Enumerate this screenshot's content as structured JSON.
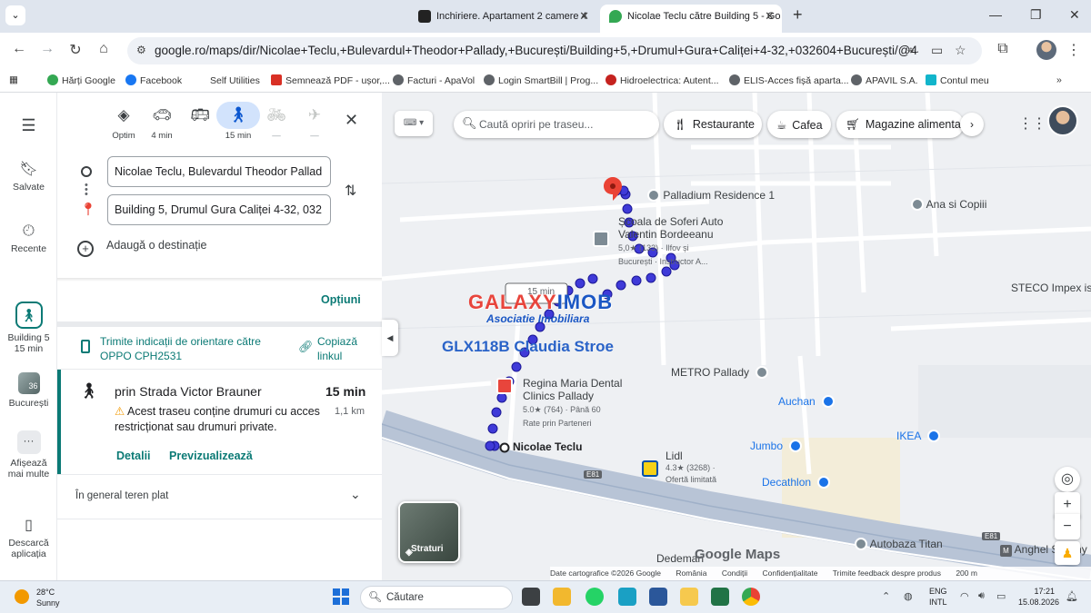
{
  "browser": {
    "tab_menu_icon": "chevron-down-icon",
    "tabs": [
      {
        "title": "Inchiriere. Apartament 2 camere 4",
        "favicon_color": "#222222",
        "active": false
      },
      {
        "title": "Nicolae Teclu către Building 5 - Go",
        "favicon_color": "#34a853",
        "active": true
      }
    ],
    "url": "google.ro/maps/dir/Nicolae+Teclu,+Bulevardul+Theodor+Pallady,+București/Building+5,+Drumul+Gura+Caliței+4-32,+032604+București/@44.409...",
    "bookmarks": [
      {
        "label": "Hărți Google",
        "color": "#34a853"
      },
      {
        "label": "Facebook",
        "color": "#1877f2"
      },
      {
        "label": "Self Utilities",
        "color": "#ffffff"
      },
      {
        "label": "Semnează PDF - ușor,...",
        "color": "#d93025"
      },
      {
        "label": "Facturi - ApaVol",
        "color": "#5f6368"
      },
      {
        "label": "Login SmartBill | Prog...",
        "color": "#5f6368"
      },
      {
        "label": "Hidroelectrica: Autent...",
        "color": "#c5221f"
      },
      {
        "label": "ELIS-Acces fișă aparta...",
        "color": "#5f6368"
      },
      {
        "label": "APAVIL S.A.",
        "color": "#5f6368"
      },
      {
        "label": "Contul meu",
        "color": "#12b5cb"
      }
    ]
  },
  "rail": {
    "saved": "Salvate",
    "recent": "Recente",
    "walk_label_1": "Building 5",
    "walk_label_2": "15 min",
    "photo_badge": "36",
    "city": "București",
    "more_1": "Afișează",
    "more_2": "mai multe",
    "download_1": "Descarcă",
    "download_2": "aplicația"
  },
  "directions": {
    "modes": [
      {
        "icon": "diamond-route-icon",
        "glyph": "◈",
        "label": "Optim"
      },
      {
        "icon": "car-icon",
        "glyph": "🚗",
        "label": "4 min"
      },
      {
        "icon": "bus-icon",
        "glyph": "🚌",
        "label": ""
      },
      {
        "icon": "walk-icon",
        "glyph": "🚶",
        "label": "15 min"
      },
      {
        "icon": "bike-icon",
        "glyph": "🚲",
        "label": "—"
      },
      {
        "icon": "plane-icon",
        "glyph": "✈",
        "label": "—"
      }
    ],
    "origin": "Nicolae Teclu, Bulevardul Theodor Pallad",
    "destination": "Building 5, Drumul Gura Caliței 4-32, 032",
    "add_destination": "Adaugă o destinație",
    "options": "Opțiuni",
    "send_to_phone": "Trimite indicații de orientare către OPPO CPH2531",
    "copy_link": "Copiază linkul",
    "route": {
      "title": "prin Strada Victor Brauner",
      "time": "15 min",
      "distance": "1,1 km",
      "warning": "Acest traseu conține drumuri cu acces restricționat sau drumuri private.",
      "details": "Detalii",
      "preview": "Previzualizează"
    },
    "terrain": "În general teren plat"
  },
  "map": {
    "search_placeholder": "Caută opriri pe traseu...",
    "chips": [
      "Restaurante",
      "Cafea",
      "Magazine alimenta"
    ],
    "places": {
      "palladium": "Palladium Residence 1",
      "ana": "Ana si Copiii",
      "scoala_1": "Școala de Soferi Auto",
      "scoala_2": "Valentin Bordeeanu",
      "scoala_3": "5,0★ (133) · Ilfov și",
      "scoala_4": "București · Instructor A...",
      "steco": "STECO Impex isr",
      "metro": "METRO Pallady",
      "regina_1": "Regina Maria Dental",
      "regina_2": "Clinics Pallady",
      "regina_3": "5.0★ (764) · Până 60",
      "regina_4": "Rate prin Parteneri",
      "auchan": "Auchan",
      "jumbo": "Jumbo",
      "ikea": "IKEA",
      "decathlon": "Decathlon",
      "teclu": "Nicolae Teclu",
      "lidl_1": "Lidl",
      "lidl_2": "4.3★ (3268) ·",
      "lidl_3": "Ofertă limitată",
      "e81a": "E81",
      "e81b": "E81",
      "dedeman": "Dedeman",
      "autobaza": "Autobaza Titan",
      "anghel": "Anghel Saligny",
      "route_time": "15 min"
    },
    "watermark_a": "GALAXY",
    "watermark_b": "IMOB",
    "watermark_sub": "Asociatie Imobiliara",
    "watermark_agent": "GLX118B Claudia Stroe",
    "layers_label": "Straturi",
    "logo": "Google Maps",
    "footer": [
      "Date cartografice ©2026 Google",
      "România",
      "Condiții",
      "Confidențialitate",
      "Trimite feedback despre produs",
      "200 m"
    ]
  },
  "taskbar": {
    "temp": "28°C",
    "weather": "Sunny",
    "search": "Căutare",
    "lang_1": "ENG",
    "lang_2": "INTL",
    "time": "17:21",
    "date": "15.08.2026"
  }
}
